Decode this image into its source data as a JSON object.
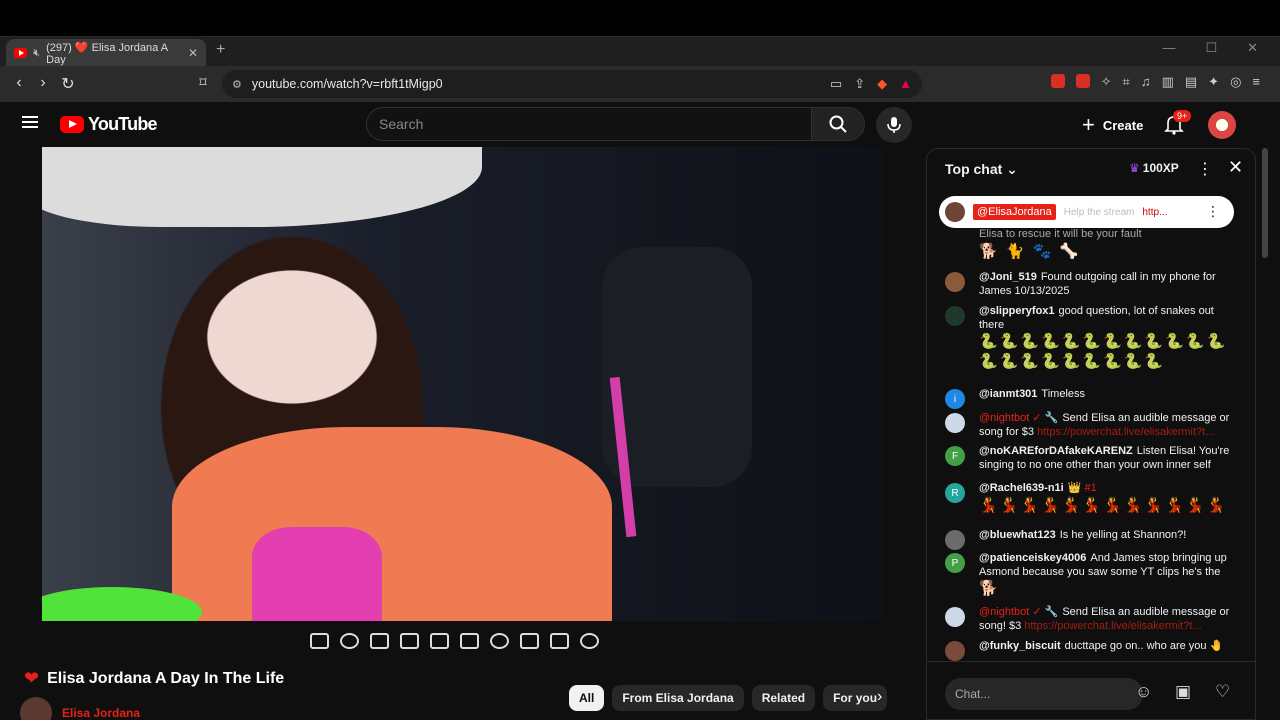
{
  "browser": {
    "tab_title": "(297) ❤️ Elisa Jordana A Day",
    "tab_close": "✕",
    "new_tab": "+",
    "url": "youtube.com/watch?v=rbft1tMigp0",
    "window_controls": [
      "—",
      "☐",
      "✕"
    ]
  },
  "youtube": {
    "logo_text": "YouTube",
    "search_placeholder": "Search",
    "create_label": "Create",
    "notification_count": "9+"
  },
  "video": {
    "title": "Elisa Jordana A Day In The Life",
    "title_icon": "heart-icon",
    "channel_name": "Elisa Jordana"
  },
  "chips": [
    {
      "label": "All",
      "active": true
    },
    {
      "label": "From Elisa Jordana",
      "active": false
    },
    {
      "label": "Related",
      "active": false
    },
    {
      "label": "For you",
      "active": false
    }
  ],
  "chat": {
    "header_title": "Top chat",
    "xp_label": "100XP",
    "pinned": {
      "author": "@ElisaJordana",
      "text": "Help the stream",
      "link": "http..."
    },
    "messages": [
      {
        "author": "",
        "text": "Elisa to rescue it will be your fault",
        "emojis": "🐕 🐈 🐾 🦴",
        "avatar_color": "#0f0f0f",
        "avatar_letter": "",
        "bot": false
      },
      {
        "author": "@Joni_519",
        "text": "Found outgoing call in my phone for James 10/13/2025",
        "emojis": "",
        "avatar_color": "#8a5a3a",
        "avatar_letter": "",
        "bot": false
      },
      {
        "author": "@slipperyfox1",
        "text": "good question, lot of snakes out there",
        "emojis": "🐍🐍🐍🐍🐍🐍🐍🐍🐍🐍🐍🐍🐍🐍🐍🐍🐍🐍🐍🐍🐍",
        "avatar_color": "#1f3a2a",
        "avatar_letter": "",
        "bot": false
      },
      {
        "author": "@ianmt301",
        "text": "Timeless",
        "emojis": "",
        "avatar_color": "#1e88e5",
        "avatar_letter": "i",
        "bot": false
      },
      {
        "author": "@nightbot ✓ 🔧",
        "text": "Send Elisa an audible message or song for $3",
        "link": "https://powerchat.live/elisakermit?t...",
        "emojis": "",
        "avatar_color": "#cfd8e8",
        "avatar_letter": "",
        "bot": true
      },
      {
        "author": "@noKAREforDAfakeKARENZ",
        "text": "Listen Elisa! You're singing to no one other than your own inner self",
        "emojis": "",
        "avatar_color": "#43a047",
        "avatar_letter": "F",
        "bot": false
      },
      {
        "author": "@Rachel639-n1i",
        "text": "👑 #1",
        "emojis": "💃💃💃💃💃💃💃💃💃💃💃💃",
        "avatar_color": "#26a69a",
        "avatar_letter": "R",
        "bot": false
      },
      {
        "author": "@bluewhat123",
        "text": "Is he yelling at Shannon?!",
        "emojis": "",
        "avatar_color": "#6b6b6b",
        "avatar_letter": "",
        "bot": false
      },
      {
        "author": "@patienceiskey4006",
        "text": "And James stop bringing up Asmond because you saw some YT clips he's the",
        "emojis": "🐕",
        "avatar_color": "#43a047",
        "avatar_letter": "P",
        "bot": false
      },
      {
        "author": "@nightbot ✓ 🔧",
        "text": "Send Elisa an audible message or song! $3",
        "link": "https://powerchat.live/elisakermit?t...",
        "emojis": "",
        "avatar_color": "#cfd8e8",
        "avatar_letter": "",
        "bot": true
      },
      {
        "author": "@funky_biscuit",
        "text": "ducttape go on.. who are you",
        "emojis": "🤚",
        "avatar_color": "#7a4a3a",
        "avatar_letter": "",
        "bot": false
      }
    ],
    "input_placeholder": "Chat..."
  }
}
